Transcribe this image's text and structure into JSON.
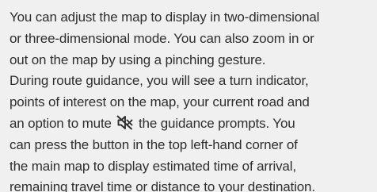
{
  "paragraph": {
    "lines": [
      "You can adjust the map to display in two-dimensional",
      "or three-dimensional mode. You can also zoom in or",
      "out on the map by using a pinching gesture.",
      "During route guidance, you will see a turn indicator,",
      "points of interest on the map, your current road and"
    ],
    "line6_before_icon": "an option to mute ",
    "line6_after_icon": " the guidance prompts. You",
    "lines_after_icon": [
      "can press the button in the top left-hand corner of",
      "the main map to display estimated time of arrival,",
      "remaining travel time or distance to your destination."
    ]
  },
  "icons": {
    "mute": "speaker-muted-icon"
  },
  "colors": {
    "background": "#f0f0f0",
    "text": "#2e2e2e"
  }
}
